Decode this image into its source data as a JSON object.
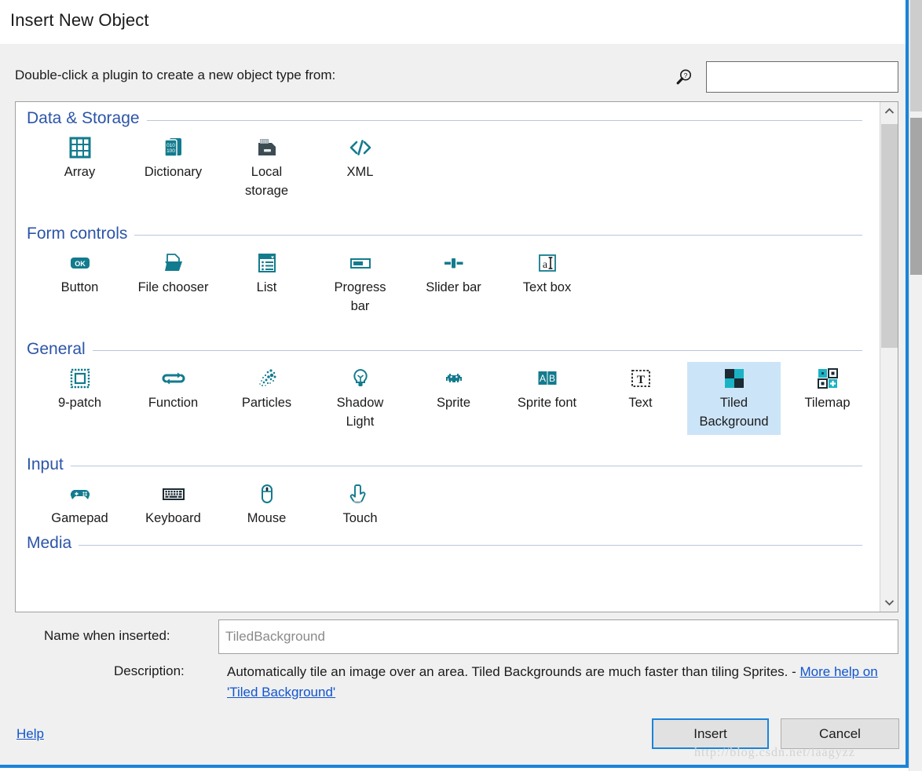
{
  "window": {
    "title": "Insert New Object",
    "accent_color": "#1a84d9",
    "group_title_color": "#2c55a8",
    "selection_color": "#cce4f7",
    "icon_color": "#137b8e"
  },
  "header": {
    "prompt": "Double-click a plugin to create a new object type from:",
    "search_icon": "search-help-magnifier-icon",
    "search_value": "",
    "search_placeholder": ""
  },
  "groups": [
    {
      "title": "Data & Storage",
      "items": [
        {
          "label": "Array",
          "icon": "grid-table-icon",
          "selected": false
        },
        {
          "label": "Dictionary",
          "icon": "binary-books-icon",
          "selected": false
        },
        {
          "label": "Local\nstorage",
          "icon": "hard-drive-icon",
          "selected": false
        },
        {
          "label": "XML",
          "icon": "code-brackets-icon",
          "selected": false
        }
      ]
    },
    {
      "title": "Form controls",
      "items": [
        {
          "label": "Button",
          "icon": "ok-button-icon",
          "selected": false
        },
        {
          "label": "File chooser",
          "icon": "open-folder-icon",
          "selected": false
        },
        {
          "label": "List",
          "icon": "list-dropdown-icon",
          "selected": false
        },
        {
          "label": "Progress\nbar",
          "icon": "progress-bar-icon",
          "selected": false
        },
        {
          "label": "Slider bar",
          "icon": "slider-handle-icon",
          "selected": false
        },
        {
          "label": "Text box",
          "icon": "text-caret-box-icon",
          "selected": false
        }
      ]
    },
    {
      "title": "General",
      "items": [
        {
          "label": "9-patch",
          "icon": "nine-patch-frame-icon",
          "selected": false
        },
        {
          "label": "Function",
          "icon": "loop-arrows-icon",
          "selected": false
        },
        {
          "label": "Particles",
          "icon": "particles-dots-icon",
          "selected": false
        },
        {
          "label": "Shadow\nLight",
          "icon": "light-bulb-icon",
          "selected": false
        },
        {
          "label": "Sprite",
          "icon": "space-invader-icon",
          "selected": false
        },
        {
          "label": "Sprite font",
          "icon": "ab-letters-icon",
          "selected": false
        },
        {
          "label": "Text",
          "icon": "dashed-t-box-icon",
          "selected": false
        },
        {
          "label": "Tiled\nBackground",
          "icon": "checker-tiles-icon",
          "selected": true
        },
        {
          "label": "Tilemap",
          "icon": "tilemap-plus-icon",
          "selected": false
        }
      ]
    },
    {
      "title": "Input",
      "items": [
        {
          "label": "Gamepad",
          "icon": "gamepad-icon",
          "selected": false
        },
        {
          "label": "Keyboard",
          "icon": "keyboard-icon",
          "selected": false
        },
        {
          "label": "Mouse",
          "icon": "mouse-icon",
          "selected": false
        },
        {
          "label": "Touch",
          "icon": "touch-hand-icon",
          "selected": false
        }
      ]
    },
    {
      "title": "Media",
      "items": []
    }
  ],
  "scrollbar": {
    "up_arrow_icon": "chevron-up-icon",
    "down_arrow_icon": "chevron-down-icon"
  },
  "form": {
    "name_label": "Name when inserted:",
    "name_value": "TiledBackground",
    "name_placeholder": "TiledBackground",
    "description_label": "Description:",
    "description_text": "Automatically tile an image over an area.  Tiled Backgrounds are much faster than tiling Sprites. - ",
    "description_link": "More help on 'Tiled Background'"
  },
  "footer": {
    "help_label": "Help",
    "insert_label": "Insert",
    "cancel_label": "Cancel"
  },
  "watermark": "http://blog.csdn.net/laagyzz"
}
